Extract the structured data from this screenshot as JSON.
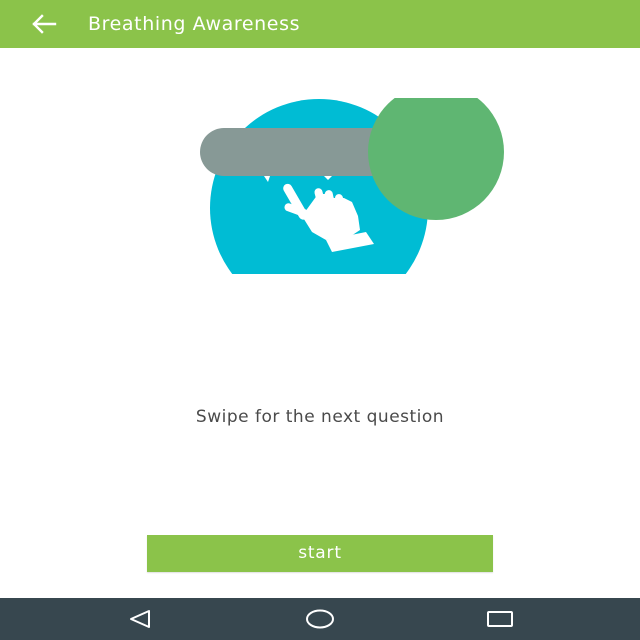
{
  "app_bar": {
    "title": "Breathing Awareness",
    "back_icon": "arrow-left-icon",
    "color": "#8bc34a"
  },
  "illustration": {
    "icons": [
      "swipe-track-icon",
      "swipe-knob-icon",
      "swipe-hand-icon"
    ],
    "colors": {
      "track": "#879996",
      "knob": "#5fb672",
      "circle": "#00bcd4",
      "hand": "#ffffff"
    }
  },
  "main": {
    "instruction": "Swipe for the next question",
    "start_label": "start"
  },
  "nav_bar": {
    "color": "#37474f",
    "items": [
      "back-triangle-icon",
      "home-circle-icon",
      "recents-square-icon"
    ]
  }
}
